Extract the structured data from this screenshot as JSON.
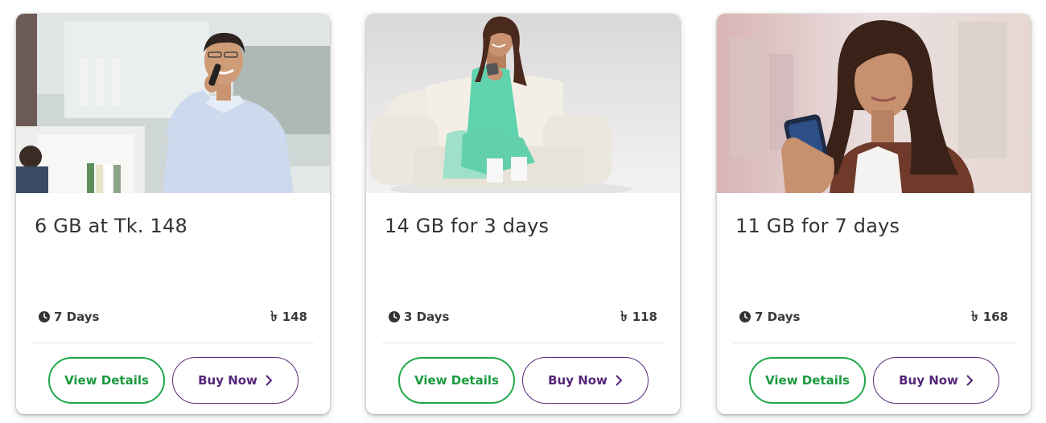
{
  "offers": [
    {
      "title": "6 GB at Tk. 148",
      "validity": "7 Days",
      "price": "148",
      "currency_symbol": "৳",
      "details_label": "View Details",
      "buy_label": "Buy Now",
      "image": "man-in-office-talking-on-phone"
    },
    {
      "title": "14 GB for 3 days",
      "validity": "3 Days",
      "price": "118",
      "currency_symbol": "৳",
      "details_label": "View Details",
      "buy_label": "Buy Now",
      "image": "woman-in-green-on-armchair-with-phone"
    },
    {
      "title": "11 GB for 7 days",
      "validity": "7 Days",
      "price": "168",
      "currency_symbol": "৳",
      "details_label": "View Details",
      "buy_label": "Buy Now",
      "image": "woman-looking-at-smartphone"
    }
  ],
  "icons": {
    "validity": "clock-icon",
    "currency": "taka-icon",
    "buy": "chevron-right-icon"
  },
  "colors": {
    "details_accent": "#1fa84a",
    "buy_accent": "#5a2b7a",
    "title_text": "#333333"
  }
}
